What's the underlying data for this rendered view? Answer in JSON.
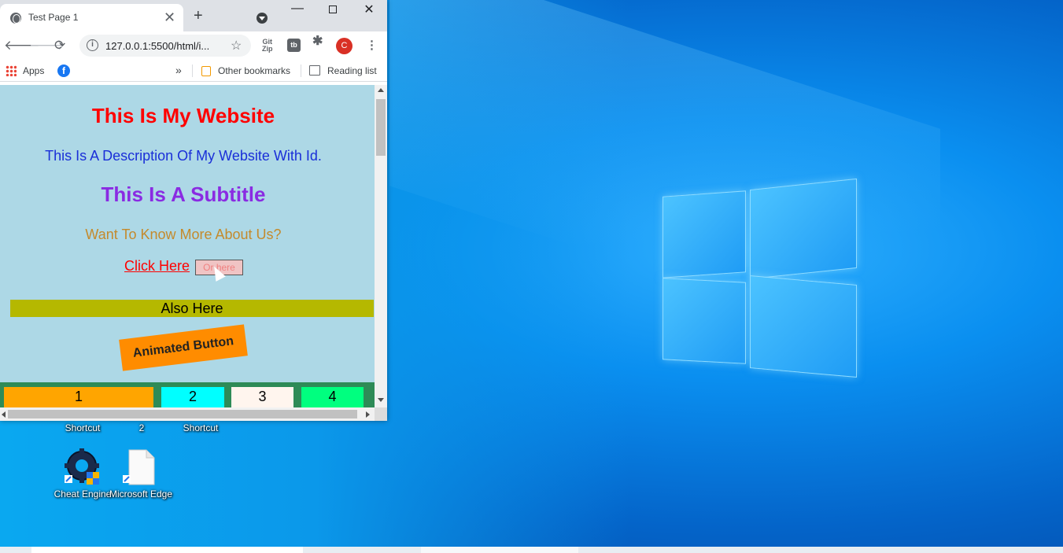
{
  "browser": {
    "tab_title": "Test Page 1",
    "tab_close": "✕",
    "new_tab": "+",
    "window_controls": {
      "minimize": "—",
      "close": "✕"
    },
    "url": "127.0.0.1:5500/html/i...",
    "avatar_letter": "C",
    "extensions": [
      "Git Zip",
      "tb"
    ],
    "bookmarks": {
      "apps": "Apps",
      "chevron": "»",
      "other": "Other bookmarks",
      "reading": "Reading list"
    }
  },
  "page": {
    "title": "This Is My Website",
    "description": "This Is A Description Of My Website With Id.",
    "subtitle": "This Is A Subtitle",
    "more": "Want To Know More About Us?",
    "click_link": "Click Here",
    "or_button": "Or here",
    "also_here": "Also Here",
    "animated_button": "Animated Button",
    "cells": [
      "1",
      "2",
      "3",
      "4"
    ]
  },
  "desktop": {
    "labels_row1": [
      "Shortcut",
      "2",
      "Shortcut"
    ],
    "icons": [
      {
        "name": "cheat-engine-icon",
        "label": "Cheat Engine"
      },
      {
        "name": "microsoft-edge-icon",
        "label": "Microsoft Edge"
      }
    ]
  }
}
